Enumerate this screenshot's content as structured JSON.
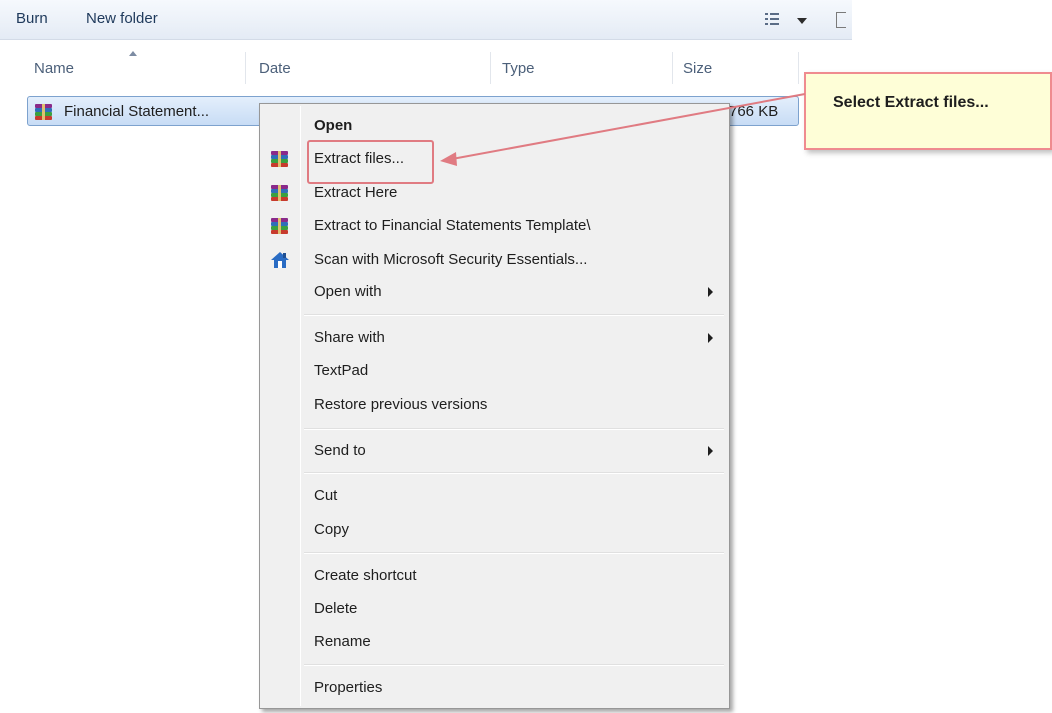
{
  "toolbar": {
    "burn": "Burn",
    "new_folder": "New folder"
  },
  "columns": {
    "name": "Name",
    "date": "Date",
    "type": "Type",
    "size": "Size"
  },
  "file": {
    "name": "Financial Statement...",
    "size": "766 KB",
    "icon": "winrar-archive-icon"
  },
  "menu": {
    "items": [
      {
        "label": "Open",
        "bold": true
      },
      {
        "label": "Extract files...",
        "icon": "winrar-icon"
      },
      {
        "label": "Extract Here",
        "icon": "winrar-icon"
      },
      {
        "label": "Extract to Financial Statements Template\\",
        "icon": "winrar-icon"
      },
      {
        "label": "Scan with Microsoft Security Essentials...",
        "icon": "security-essentials-icon"
      },
      {
        "label": "Open with",
        "submenu": true
      },
      {
        "label": "Share with",
        "submenu": true
      },
      {
        "label": "TextPad"
      },
      {
        "label": "Restore previous versions"
      },
      {
        "label": "Send to",
        "submenu": true
      },
      {
        "label": "Cut"
      },
      {
        "label": "Copy"
      },
      {
        "label": "Create shortcut"
      },
      {
        "label": "Delete"
      },
      {
        "label": "Rename"
      },
      {
        "label": "Properties"
      }
    ]
  },
  "callout": {
    "text": "Select Extract files..."
  },
  "colors": {
    "highlight": "#e07b82",
    "callout_bg": "#fefed7",
    "selection": "#c8dcf5"
  }
}
